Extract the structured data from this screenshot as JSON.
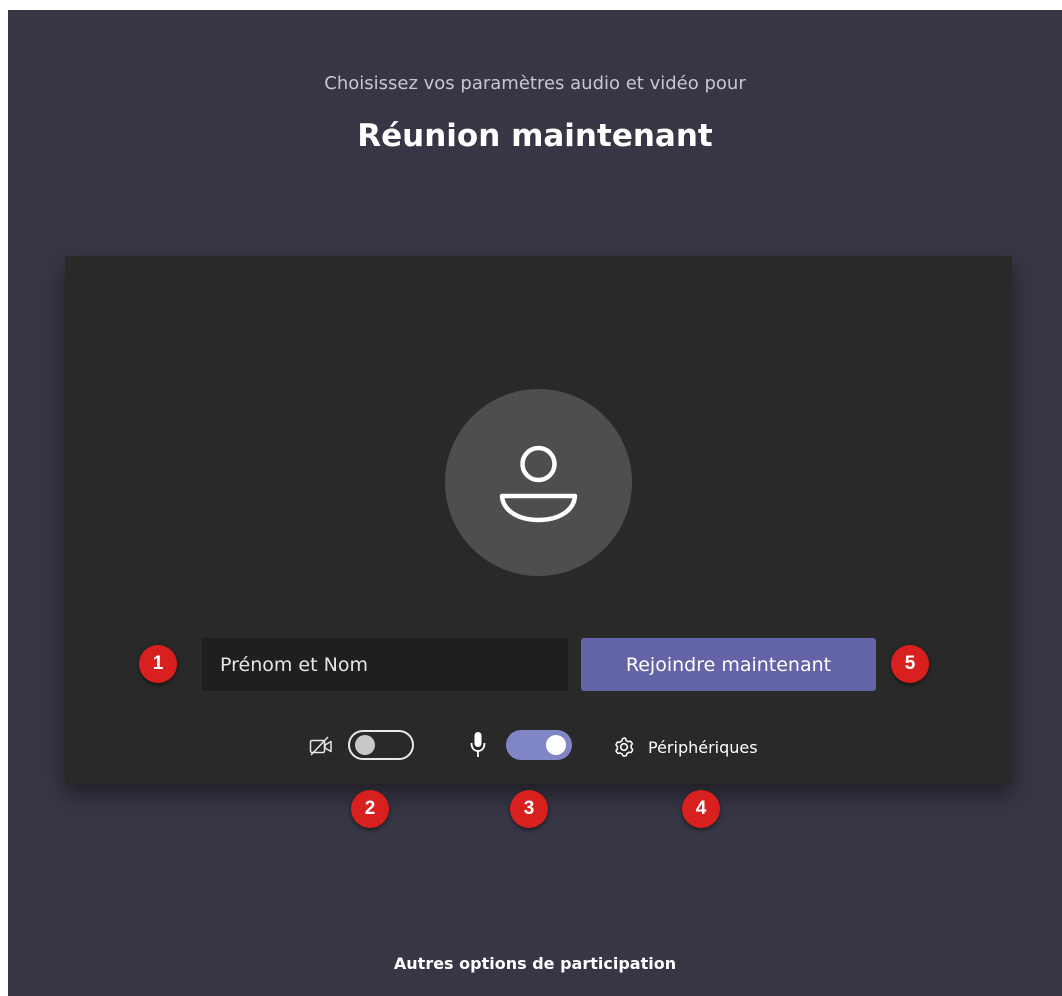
{
  "header": {
    "subtitle": "Choisissez vos paramètres audio et vidéo pour",
    "title": "Réunion maintenant"
  },
  "join_form": {
    "name_placeholder": "Prénom et Nom",
    "join_label": "Rejoindre maintenant"
  },
  "controls": {
    "camera": {
      "icon": "camera-off-icon",
      "enabled": false
    },
    "microphone": {
      "icon": "microphone-icon",
      "enabled": true
    },
    "devices_label": "Périphériques",
    "devices_icon": "gear-icon"
  },
  "annotations": [
    "1",
    "2",
    "3",
    "4",
    "5"
  ],
  "footer": {
    "other_options_label": "Autres options de participation"
  },
  "colors": {
    "background": "#373645",
    "panel": "#292929",
    "accent": "#6264a7",
    "toggle_on": "#7f85c5",
    "marker": "#d8201f"
  }
}
